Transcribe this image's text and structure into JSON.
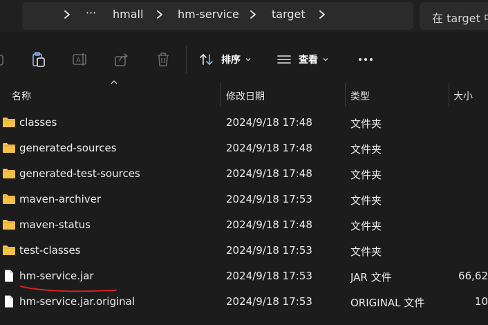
{
  "address_bar": {
    "crumbs": [
      "hmall",
      "hm-service",
      "target"
    ],
    "search_placeholder": "在 target 中"
  },
  "toolbar": {
    "sort_label": "排序",
    "view_label": "查看"
  },
  "columns": {
    "name": "名称",
    "date": "修改日期",
    "type": "类型",
    "size": "大小"
  },
  "files": [
    {
      "name": "classes",
      "date": "2024/9/18 17:48",
      "type": "文件夹",
      "size": "",
      "kind": "folder"
    },
    {
      "name": "generated-sources",
      "date": "2024/9/18 17:48",
      "type": "文件夹",
      "size": "",
      "kind": "folder"
    },
    {
      "name": "generated-test-sources",
      "date": "2024/9/18 17:48",
      "type": "文件夹",
      "size": "",
      "kind": "folder"
    },
    {
      "name": "maven-archiver",
      "date": "2024/9/18 17:53",
      "type": "文件夹",
      "size": "",
      "kind": "folder"
    },
    {
      "name": "maven-status",
      "date": "2024/9/18 17:48",
      "type": "文件夹",
      "size": "",
      "kind": "folder"
    },
    {
      "name": "test-classes",
      "date": "2024/9/18 17:53",
      "type": "文件夹",
      "size": "",
      "kind": "folder"
    },
    {
      "name": "hm-service.jar",
      "date": "2024/9/18 17:53",
      "type": "JAR 文件",
      "size": "66,62",
      "kind": "file"
    },
    {
      "name": "hm-service.jar.original",
      "date": "2024/9/18 17:53",
      "type": "ORIGINAL 文件",
      "size": "10",
      "kind": "file"
    }
  ],
  "colors": {
    "folder": "#f4c045",
    "annotation": "#d42020"
  }
}
